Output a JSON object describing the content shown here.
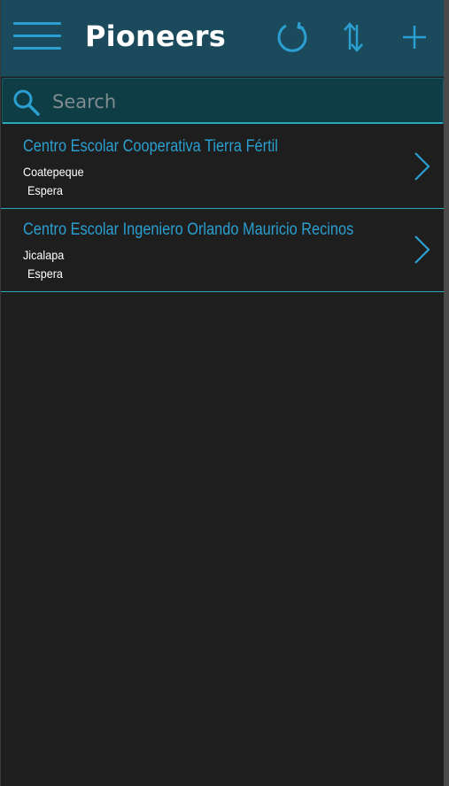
{
  "header": {
    "title": "Pioneers",
    "menu_icon": "hamburger-menu-icon",
    "refresh_icon": "refresh-icon",
    "sort_icon": "sort-icon",
    "add_icon": "plus-icon"
  },
  "search": {
    "placeholder": "Search",
    "value": ""
  },
  "list": {
    "items": [
      {
        "title": "Centro Escolar Cooperativa Tierra Fértil",
        "location": "Coatepeque",
        "status": "Espera"
      },
      {
        "title": "Centro Escolar Ingeniero Orlando Mauricio Recinos",
        "location": "Jicalapa",
        "status": "Espera"
      }
    ]
  },
  "colors": {
    "header_bg": "#1b4a5c",
    "accent": "#2a9fd0",
    "background": "#1e1e1e",
    "divider": "#2aa7b8"
  }
}
